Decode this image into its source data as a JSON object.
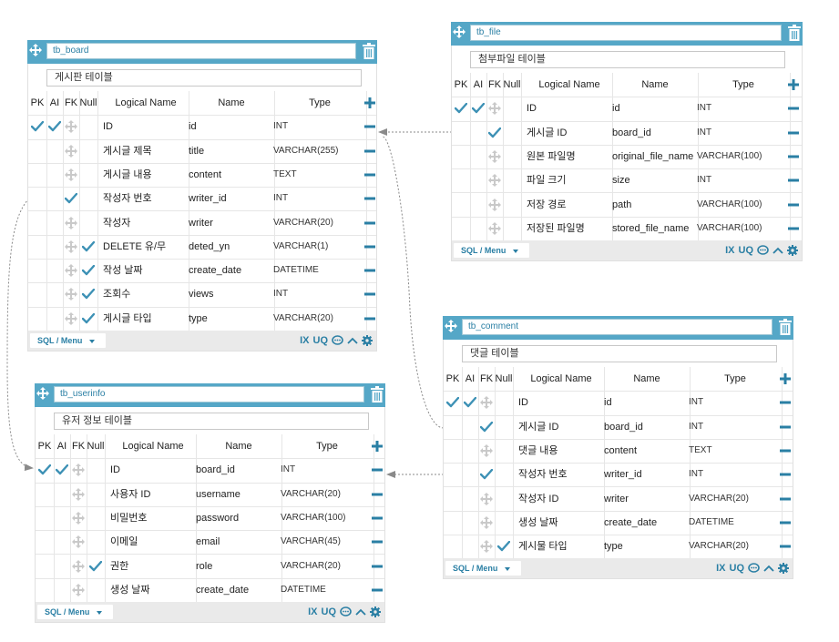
{
  "tables": [
    {
      "id": "tb_board",
      "name": "tb_board",
      "comment": "게시판 테이블",
      "headers": {
        "pk": "PK",
        "ai": "AI",
        "fk": "FK",
        "nn": "Null",
        "logical": "Logical Name",
        "name": "Name",
        "type": "Type"
      },
      "rows": [
        {
          "pk": true,
          "ai": true,
          "fk": false,
          "nn": false,
          "logical": "ID",
          "name": "id",
          "type": "INT"
        },
        {
          "pk": false,
          "ai": false,
          "fk": false,
          "nn": false,
          "logical": "게시글 제목",
          "name": "title",
          "type": "VARCHAR(255)"
        },
        {
          "pk": false,
          "ai": false,
          "fk": false,
          "nn": false,
          "logical": "게시글 내용",
          "name": "content",
          "type": "TEXT"
        },
        {
          "pk": false,
          "ai": false,
          "fk": true,
          "nn": false,
          "logical": "작성자 번호",
          "name": "writer_id",
          "type": "INT"
        },
        {
          "pk": false,
          "ai": false,
          "fk": false,
          "nn": false,
          "logical": "작성자",
          "name": "writer",
          "type": "VARCHAR(20)"
        },
        {
          "pk": false,
          "ai": false,
          "fk": false,
          "nn": true,
          "logical": "DELETE 유/무",
          "name": "deted_yn",
          "type": "VARCHAR(1)"
        },
        {
          "pk": false,
          "ai": false,
          "fk": false,
          "nn": true,
          "logical": "작성 날짜",
          "name": "create_date",
          "type": "DATETIME"
        },
        {
          "pk": false,
          "ai": false,
          "fk": false,
          "nn": true,
          "logical": "조회수",
          "name": "views",
          "type": "INT"
        },
        {
          "pk": false,
          "ai": false,
          "fk": false,
          "nn": true,
          "logical": "게시글 타입",
          "name": "type",
          "type": "VARCHAR(20)"
        }
      ],
      "footer": {
        "menu": "SQL / Menu",
        "ix": "IX",
        "uq": "UQ"
      }
    },
    {
      "id": "tb_file",
      "name": "tb_file",
      "comment": "첨부파일 테이블",
      "headers": {
        "pk": "PK",
        "ai": "AI",
        "fk": "FK",
        "nn": "Null",
        "logical": "Logical Name",
        "name": "Name",
        "type": "Type"
      },
      "rows": [
        {
          "pk": true,
          "ai": true,
          "fk": false,
          "nn": false,
          "logical": "ID",
          "name": "id",
          "type": "INT"
        },
        {
          "pk": false,
          "ai": false,
          "fk": true,
          "nn": false,
          "logical": "게시글 ID",
          "name": "board_id",
          "type": "INT"
        },
        {
          "pk": false,
          "ai": false,
          "fk": false,
          "nn": false,
          "logical": "원본 파일명",
          "name": "original_file_name",
          "type": "VARCHAR(100)"
        },
        {
          "pk": false,
          "ai": false,
          "fk": false,
          "nn": false,
          "logical": "파일 크기",
          "name": "size",
          "type": "INT"
        },
        {
          "pk": false,
          "ai": false,
          "fk": false,
          "nn": false,
          "logical": "저장 경로",
          "name": "path",
          "type": "VARCHAR(100)"
        },
        {
          "pk": false,
          "ai": false,
          "fk": false,
          "nn": false,
          "logical": "저장된 파일명",
          "name": "stored_file_name",
          "type": "VARCHAR(100)"
        }
      ],
      "footer": {
        "menu": "SQL / Menu",
        "ix": "IX",
        "uq": "UQ"
      }
    },
    {
      "id": "tb_comment",
      "name": "tb_comment",
      "comment": "댓글 테이블",
      "headers": {
        "pk": "PK",
        "ai": "AI",
        "fk": "FK",
        "nn": "Null",
        "logical": "Logical Name",
        "name": "Name",
        "type": "Type"
      },
      "rows": [
        {
          "pk": true,
          "ai": true,
          "fk": false,
          "nn": false,
          "logical": "ID",
          "name": "id",
          "type": "INT"
        },
        {
          "pk": false,
          "ai": false,
          "fk": true,
          "nn": false,
          "logical": "게시글 ID",
          "name": "board_id",
          "type": "INT"
        },
        {
          "pk": false,
          "ai": false,
          "fk": false,
          "nn": false,
          "logical": "댓글 내용",
          "name": "content",
          "type": "TEXT"
        },
        {
          "pk": false,
          "ai": false,
          "fk": true,
          "nn": false,
          "logical": "작성자 번호",
          "name": "writer_id",
          "type": "INT"
        },
        {
          "pk": false,
          "ai": false,
          "fk": false,
          "nn": false,
          "logical": "작성자 ID",
          "name": "writer",
          "type": "VARCHAR(20)"
        },
        {
          "pk": false,
          "ai": false,
          "fk": false,
          "nn": false,
          "logical": "생성 날짜",
          "name": "create_date",
          "type": "DATETIME"
        },
        {
          "pk": false,
          "ai": false,
          "fk": false,
          "nn": true,
          "logical": "게시물 타입",
          "name": "type",
          "type": "VARCHAR(20)"
        }
      ],
      "footer": {
        "menu": "SQL / Menu",
        "ix": "IX",
        "uq": "UQ"
      }
    },
    {
      "id": "tb_userinfo",
      "name": "tb_userinfo",
      "comment": "유저 정보 테이블",
      "headers": {
        "pk": "PK",
        "ai": "AI",
        "fk": "FK",
        "nn": "Null",
        "logical": "Logical Name",
        "name": "Name",
        "type": "Type"
      },
      "rows": [
        {
          "pk": true,
          "ai": true,
          "fk": false,
          "nn": false,
          "logical": "ID",
          "name": "board_id",
          "type": "INT"
        },
        {
          "pk": false,
          "ai": false,
          "fk": false,
          "nn": false,
          "logical": "사용자 ID",
          "name": "username",
          "type": "VARCHAR(20)"
        },
        {
          "pk": false,
          "ai": false,
          "fk": false,
          "nn": false,
          "logical": "비밀번호",
          "name": "password",
          "type": "VARCHAR(100)"
        },
        {
          "pk": false,
          "ai": false,
          "fk": false,
          "nn": false,
          "logical": "이메일",
          "name": "email",
          "type": "VARCHAR(45)"
        },
        {
          "pk": false,
          "ai": false,
          "fk": false,
          "nn": true,
          "logical": "권한",
          "name": "role",
          "type": "VARCHAR(20)"
        },
        {
          "pk": false,
          "ai": false,
          "fk": false,
          "nn": false,
          "logical": "생성 날짜",
          "name": "create_date",
          "type": "DATETIME"
        }
      ],
      "footer": {
        "menu": "SQL / Menu",
        "ix": "IX",
        "uq": "UQ"
      }
    }
  ],
  "colors": {
    "header": "#55a7c7",
    "accent": "#2a7fa4",
    "check": "#3d91b5",
    "link": "#888888"
  },
  "icons": {
    "move": "move-icon",
    "trash": "trash-icon",
    "check": "check-icon",
    "plus": "plus-icon",
    "minus": "minus-icon",
    "comment": "comment-icon",
    "collapse": "chevron-up-icon",
    "settings": "gear-icon",
    "dropdown": "caret-down-icon"
  },
  "relations": [
    {
      "from": "tb_file",
      "to": "tb_board"
    },
    {
      "from": "tb_comment",
      "to": "tb_board"
    },
    {
      "from": "tb_board",
      "to": "tb_userinfo"
    },
    {
      "from": "tb_comment",
      "to": "tb_userinfo"
    }
  ]
}
